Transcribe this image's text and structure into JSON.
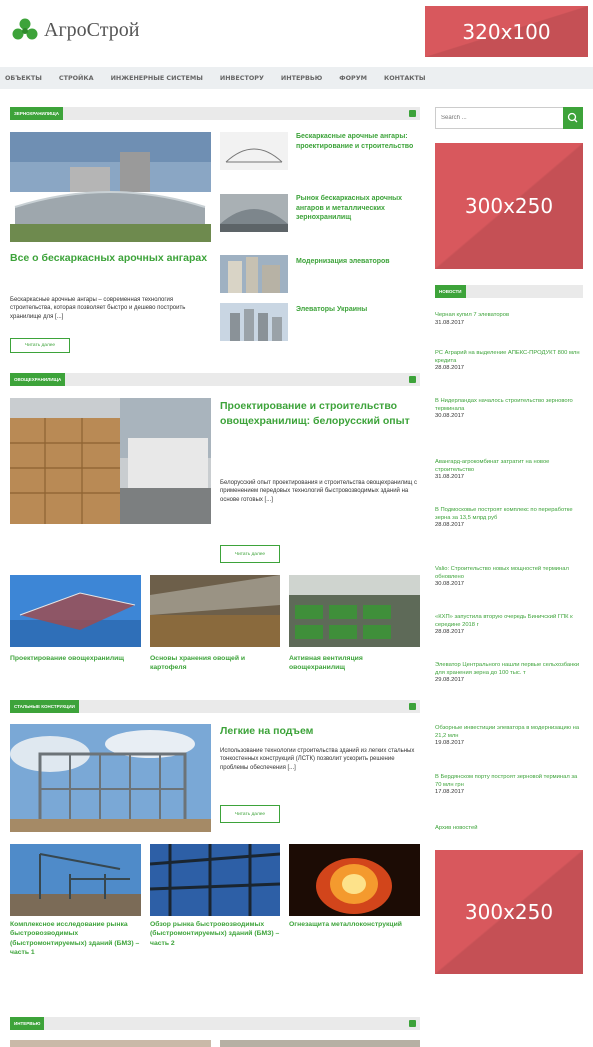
{
  "site": {
    "logo_text": "АгроСтрой",
    "ad_top": "320x100",
    "ad_side_1": "300x250",
    "ad_side_2": "300x250"
  },
  "nav": {
    "items": [
      "Объекты",
      "Стройка",
      "Инженерные системы",
      "Инвестору",
      "Интервью",
      "Форум",
      "Контакты"
    ]
  },
  "section1": {
    "tag": "Зернохранилища",
    "featured_title": "Все о бескаркасных арочных ангарах",
    "featured_excerpt": "Бескаркасные арочные ангары – современная технология строительства, которая позволяет быстро и дешево построить хранилище для [...]",
    "more": "Читать далее",
    "side_posts": [
      "Бескаркасные арочные ангары: проектирование и строительство",
      "Рынок бескаркасных арочных ангаров и металлических зернохранилищ",
      "Модернизация элеваторов",
      "Элеваторы Украины"
    ]
  },
  "section2": {
    "tag": "Овощехранилища",
    "featured_title": "Проектирование и строительство овощехранилищ: белорусский опыт",
    "featured_excerpt": "Белорусский опыт проектирования и строительства овощехранилищ с применением передовых технологий быстровозводимых зданий на основе готовых [...]",
    "more": "Читать далее",
    "cards": [
      "Проектирование овощехранилищ",
      "Основы хранения овощей и картофеля",
      "Активная вентиляция овощехранилищ"
    ]
  },
  "section3": {
    "tag": "Стальные конструкции",
    "featured_title": "Легкие на подъем",
    "featured_excerpt": "Использование технологии строительства зданий из легких стальных тонкостенных конструкций (ЛСТК) позволит ускорить решение проблемы обеспечения [...]",
    "more": "Читать далее",
    "cards": [
      "Комплексное исследование рынка быстровозводимых (быстромонтируемых) зданий (БМЗ) – часть 1",
      "Обзор рынка быстровозводимых (быстромонтируемых) зданий (БМЗ) – часть 2",
      "Огнезащита металлоконструкций"
    ]
  },
  "section4": {
    "tag": "Интервью"
  },
  "sidebar": {
    "search_placeholder": "Search ...",
    "news_tag": "Новости",
    "news": [
      {
        "title": "Черная купил 7 элеваторов",
        "date": "31.08.2017"
      },
      {
        "title": "РС Аграрий на выделение АПЕКС-ПРОДУКТ 800 млн кредита",
        "date": "28.08.2017"
      },
      {
        "title": "В Нидерландах началось строительство зернового терминала",
        "date": "30.08.2017"
      },
      {
        "title": "Авангард-агрокомбинат затратит на новое строительство",
        "date": "31.08.2017"
      },
      {
        "title": "В Подмосковье построят комплекс по переработке зерна за 13,5 млрд руб",
        "date": "28.08.2017"
      },
      {
        "title": "Valio: Строительство новых мощностей терминал обновлено",
        "date": "30.08.2017"
      },
      {
        "title": "«КХП» запустила вторую очередь Биничский ГПК к середине 2018 г",
        "date": "28.08.2017"
      },
      {
        "title": "Элеватор Центрального нашли первые сельхозбанки для хранения зерна до 100 тыс. т",
        "date": "29.08.2017"
      },
      {
        "title": "Обзорные инвестиции элеватора в модернизацию на 21,2 млн",
        "date": "19.08.2017"
      },
      {
        "title": "В Бердянском порту построят зерновой терминал за 70 млн грн",
        "date": "17.08.2017"
      }
    ],
    "all_news": "Архив новостей"
  }
}
